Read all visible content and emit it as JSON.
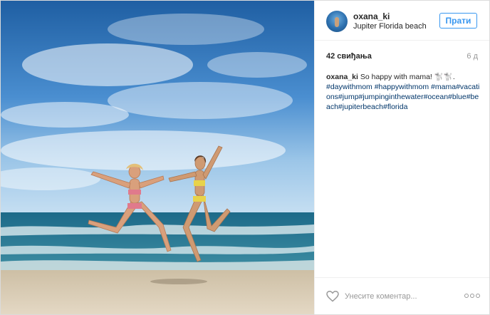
{
  "post": {
    "photo_icon": "beach-photo",
    "header": {
      "username": "oxana_ki",
      "location": "Jupiter Florida beach",
      "follow_label": "Прати"
    },
    "likes_text": "42 свиђања",
    "age_text": "6 д",
    "caption": {
      "author": "oxana_ki",
      "text": " So happy with mama! 🐩🐩.",
      "hashtags": "#daywithmom #happywithmom #mama#vacations#jump#jumpinginthewater#ocean#blue#beach#jupiterbeach#florida"
    },
    "footer": {
      "comment_placeholder": "Унесите коментар...",
      "heart_icon": "heart-icon",
      "more_icon": "more-options-icon"
    }
  }
}
